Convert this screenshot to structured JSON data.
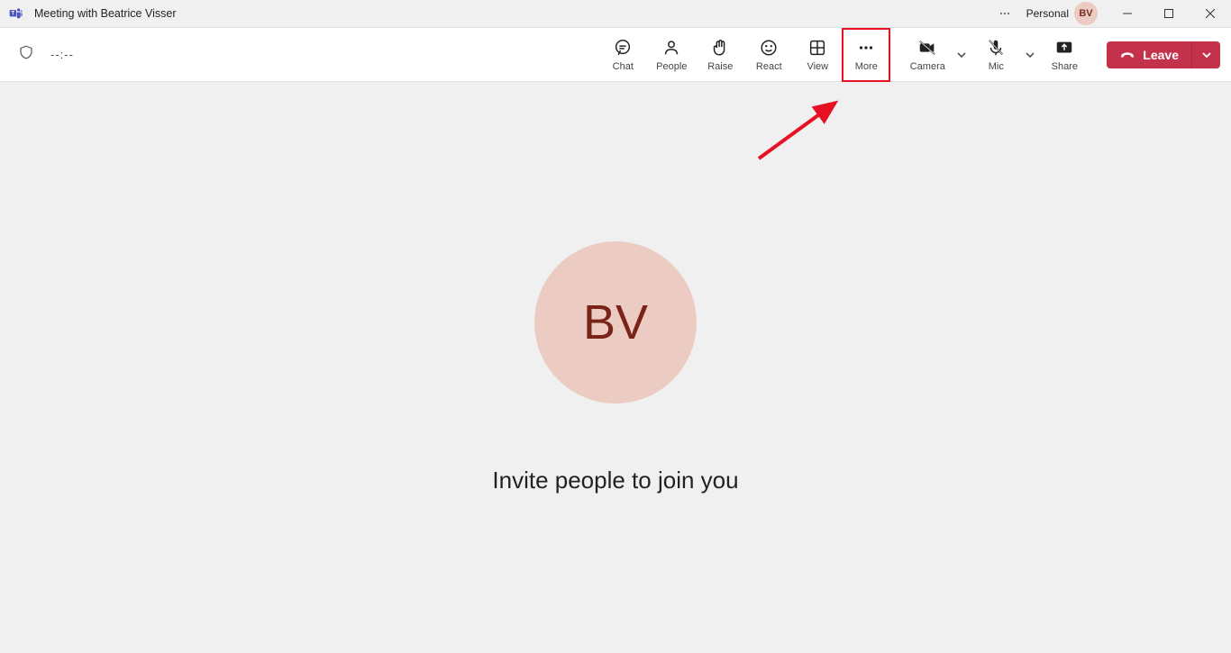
{
  "titlebar": {
    "title": "Meeting with Beatrice Visser",
    "account_type": "Personal",
    "avatar_initials": "BV"
  },
  "toolbar": {
    "timer": "--:--",
    "chat": "Chat",
    "people": "People",
    "raise": "Raise",
    "react": "React",
    "view": "View",
    "more": "More",
    "camera": "Camera",
    "mic": "Mic",
    "share": "Share",
    "leave": "Leave"
  },
  "main": {
    "avatar_initials": "BV",
    "invite_text": "Invite people to join you"
  }
}
